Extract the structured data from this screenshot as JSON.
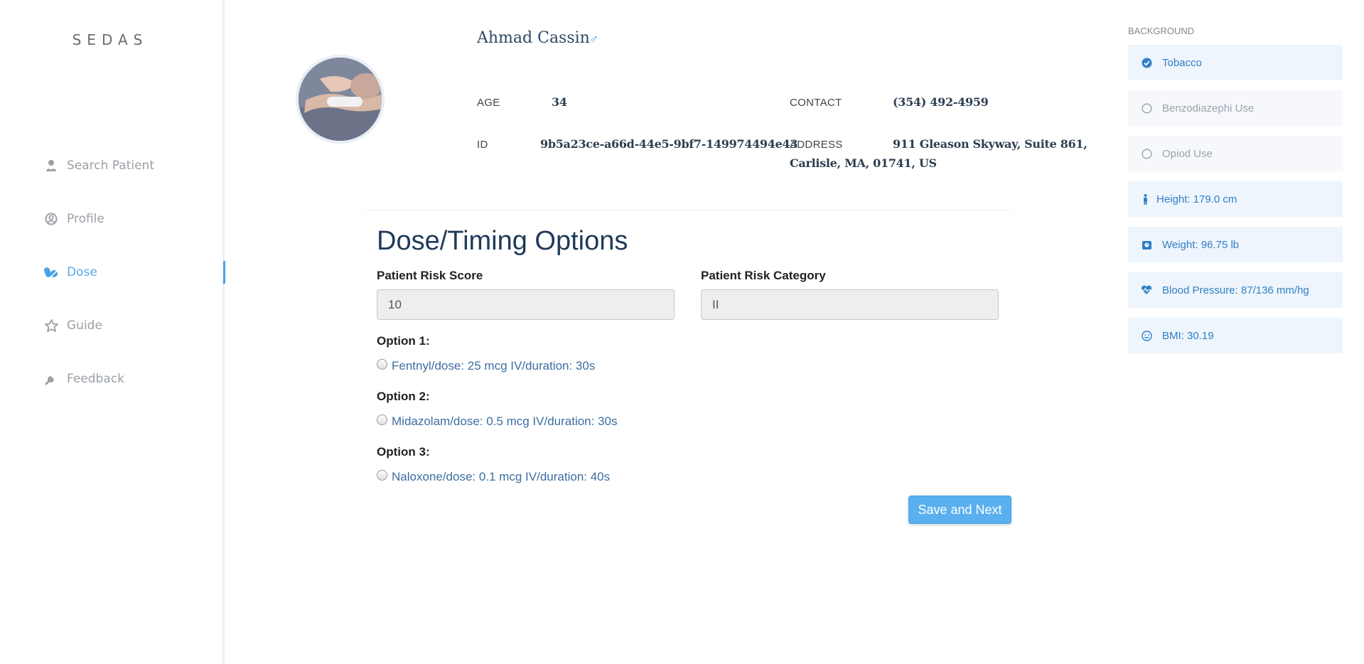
{
  "sidebar": {
    "brand": "SEDAS",
    "items": [
      {
        "label": "Search Patient",
        "icon": "user-icon"
      },
      {
        "label": "Profile",
        "icon": "user-circle-icon"
      },
      {
        "label": "Dose",
        "icon": "pills-icon"
      },
      {
        "label": "Guide",
        "icon": "star-icon"
      },
      {
        "label": "Feedback",
        "icon": "wrench-icon"
      }
    ],
    "active_item": "Dose"
  },
  "patient": {
    "name": "Ahmad Cassin",
    "gender_symbol": "♂",
    "age_label": "AGE",
    "age": "34",
    "contact_label": "CONTACT",
    "contact": "(354) 492-4959",
    "id_label": "ID",
    "id": "9b5a23ce-a66d-44e5-9bf7-149974494e43",
    "address_label": "ADDRESS",
    "address_line1": "911 Gleason Skyway, Suite 861,",
    "address_line2": "Carlisle, MA, 01741, US"
  },
  "dose": {
    "title": "Dose/Timing Options",
    "risk_score_label": "Patient Risk Score",
    "risk_score_value": "10",
    "risk_category_label": "Patient Risk Category",
    "risk_category_value": "II",
    "options": [
      {
        "title": "Option 1:",
        "text": "Fentnyl/dose: 25 mcg IV/duration: 30s"
      },
      {
        "title": "Option 2:",
        "text": "Midazolam/dose: 0.5 mcg IV/duration: 30s"
      },
      {
        "title": "Option 3:",
        "text": "Naloxone/dose: 0.1 mcg IV/duration: 40s"
      }
    ],
    "save_label": "Save and Next"
  },
  "background": {
    "title": "BACKGROUND",
    "items": [
      {
        "label": "Tobacco",
        "icon": "check-circle-icon",
        "active": true
      },
      {
        "label": "Benzodiazephi Use",
        "icon": "circle-icon",
        "active": false
      },
      {
        "label": "Opiod Use",
        "icon": "circle-icon",
        "active": false
      }
    ]
  },
  "vitals": [
    {
      "label": "Height: 179.0 cm",
      "icon": "person-icon"
    },
    {
      "label": "Weight: 96.75 lb",
      "icon": "scale-icon"
    },
    {
      "label": "Blood Pressure: 87/136 mm/hg",
      "icon": "heartbeat-icon"
    },
    {
      "label": "BMI: 30.19",
      "icon": "smile-icon"
    }
  ],
  "colors": {
    "accent": "#4aa3e8",
    "title": "#1f3a5a",
    "option_text": "#3c6ea0"
  }
}
